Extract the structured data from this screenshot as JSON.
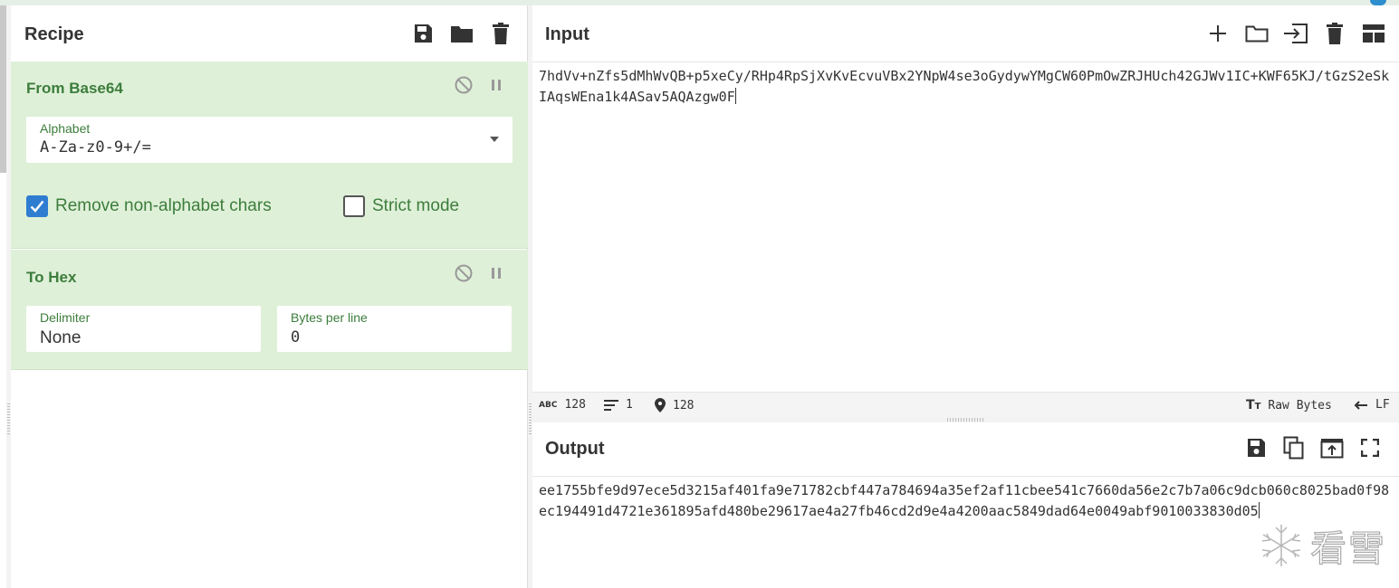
{
  "recipe": {
    "title": "Recipe",
    "icons": [
      "save-icon",
      "folder-icon",
      "trash-icon"
    ],
    "operations": [
      {
        "name": "From Base64",
        "alphabet_label": "Alphabet",
        "alphabet_value": "A-Za-z0-9+/=",
        "remove_non_alphabet_label": "Remove non-alphabet chars",
        "remove_non_alphabet_checked": true,
        "strict_mode_label": "Strict mode",
        "strict_mode_checked": false
      },
      {
        "name": "To Hex",
        "delimiter_label": "Delimiter",
        "delimiter_value": "None",
        "bytes_per_line_label": "Bytes per line",
        "bytes_per_line_value": "0"
      }
    ]
  },
  "input": {
    "title": "Input",
    "icons": [
      "plus-icon",
      "folder-icon",
      "import-icon",
      "trash-icon",
      "layout-icon"
    ],
    "text": "7hdVv+nZfs5dMhWvQB+p5xeCy/RHp4RpSjXvKvEcvuVBx2YNpW4se3oGydywYMgCW60PmOwZRJHUch42GJWv1IC+KWF65KJ/tGzS2eSkIAqsWEna1k4ASav5AQAzgw0F"
  },
  "status": {
    "chars": "128",
    "lines": "1",
    "position": "128",
    "encoding": "Raw Bytes",
    "eol": "LF"
  },
  "output": {
    "title": "Output",
    "icons": [
      "save-icon",
      "copy-icon",
      "replace-input-icon",
      "fullscreen-icon"
    ],
    "text": "ee1755bfe9d97ece5d3215af401fa9e71782cbf447a784694a35ef2af11cbee541c7660da56e2c7b7a06c9dcb060c8025bad0f98ec194491d4721e361895afd480be29617ae4a27fb46cd2d9e4a4200aac5849dad64e0049abf9010033830d05"
  },
  "watermark": {
    "text": "看雪"
  },
  "colors": {
    "op_bg": "#dff0d8",
    "op_text": "#3c7d3c",
    "checkbox": "#2e7dd1"
  }
}
